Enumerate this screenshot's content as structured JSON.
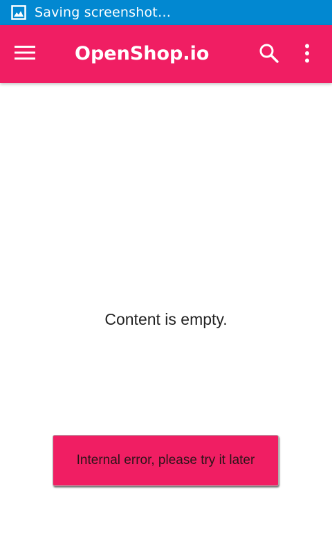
{
  "status_bar": {
    "notification_icon": "image-icon",
    "text": "Saving screenshot…",
    "background_color": "#0288d1"
  },
  "app_bar": {
    "title": "OpenShop.io",
    "background_color": "#f01e63",
    "menu_icon": "hamburger-menu-icon",
    "search_icon": "search-icon",
    "overflow_icon": "more-vert-icon"
  },
  "content": {
    "empty_message": "Content is empty."
  },
  "toast": {
    "message": "Internal error, please try it later",
    "background_color": "#f01e63"
  }
}
